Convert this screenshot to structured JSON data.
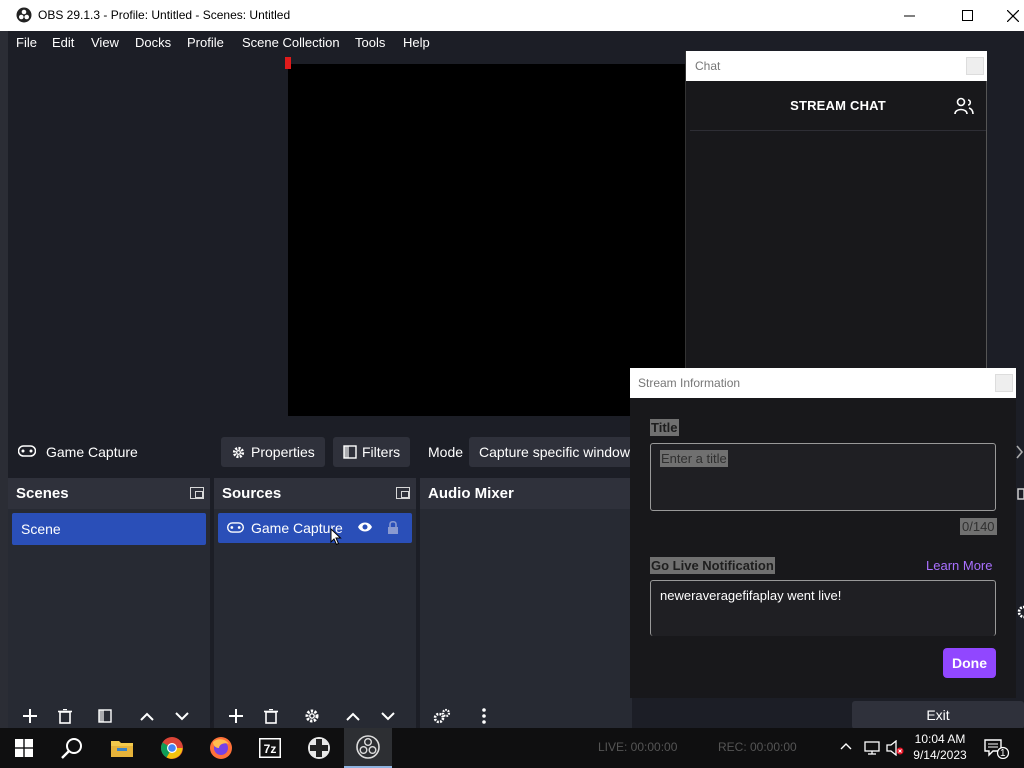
{
  "window": {
    "title": "OBS 29.1.3 - Profile: Untitled - Scenes: Untitled",
    "minimize": "minimize",
    "maximize": "maximize",
    "close": "close"
  },
  "menu": [
    "File",
    "Edit",
    "View",
    "Docks",
    "Profile",
    "Scene Collection",
    "Tools",
    "Help"
  ],
  "chat_dock": {
    "dock_title": "Chat",
    "header": "STREAM CHAT"
  },
  "source_toolbar": {
    "source_name": "Game Capture",
    "properties_label": "Properties",
    "filters_label": "Filters",
    "mode_label": "Mode",
    "mode_value": "Capture specific window"
  },
  "scenes": {
    "title": "Scenes",
    "items": [
      "Scene"
    ]
  },
  "sources": {
    "title": "Sources",
    "items": [
      "Game Capture"
    ]
  },
  "mixer": {
    "title": "Audio Mixer"
  },
  "stream_info": {
    "dock_title": "Stream Information",
    "title_label": "Title",
    "title_placeholder": "Enter a title",
    "char_count": "0/140",
    "notification_label": "Go Live Notification",
    "learn_more": "Learn More",
    "notification_text": "neweraveragefifaplay went live!",
    "done_label": "Done"
  },
  "controls": {
    "exit_label": "Exit"
  },
  "taskbar": {
    "live": "LIVE: 00:00:00",
    "rec": "REC: 00:00:00",
    "time": "10:04 AM",
    "date": "9/14/2023",
    "notification_count": "1"
  },
  "colors": {
    "selection": "#2a4fb8",
    "twitch_purple": "#9147ff",
    "learn_more": "#a970ff",
    "dock_bg": "#272a33"
  }
}
